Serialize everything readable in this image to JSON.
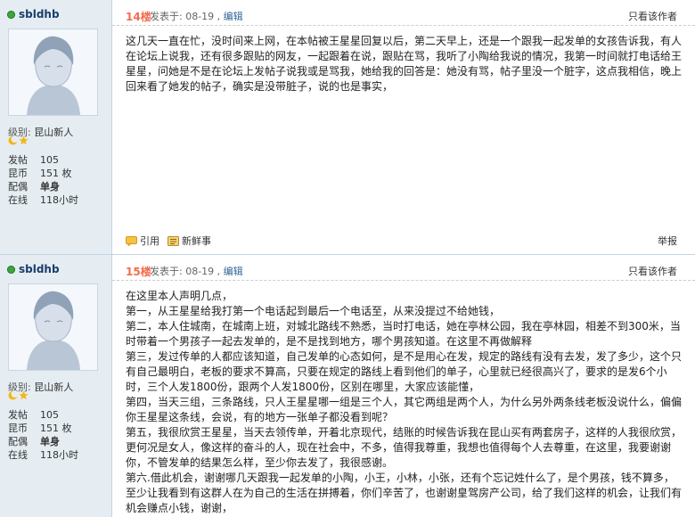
{
  "posts": [
    {
      "user": {
        "name": "sbldhb",
        "level_label": "级别:",
        "level": "昆山新人",
        "stats": [
          {
            "label": "发帖",
            "value": "105"
          },
          {
            "label": "昆币",
            "value": "151 枚"
          },
          {
            "label": "配偶",
            "value": "单身"
          },
          {
            "label": "在线",
            "value": "118小时"
          }
        ]
      },
      "floor": "14楼",
      "posted": "发表于: 08-19 , ",
      "edit": "编辑",
      "author_only": "只看该作者",
      "paragraphs": [
        "这几天一直在忙，没时间来上网，在本帖被王星星回复以后，第二天早上，还是一个跟我一起发单的女孩告诉我，有人在论坛上说我，还有很多跟贴的网友，一起跟着在说，跟贴在骂，我听了小陶给我说的情况，我第一时间就打电话给王星星，问她是不是在论坛上发帖子说我或是骂我，她给我的回答是：她没有骂，帖子里没一个脏字，这点我相信，晚上回来看了她发的帖子，确实是没带脏子，说的也是事实，"
      ],
      "actions": {
        "quote": "引用",
        "news": "新鲜事",
        "report": "举报"
      }
    },
    {
      "user": {
        "name": "sbldhb",
        "level_label": "级别:",
        "level": "昆山新人",
        "stats": [
          {
            "label": "发帖",
            "value": "105"
          },
          {
            "label": "昆币",
            "value": "151 枚"
          },
          {
            "label": "配偶",
            "value": "单身"
          },
          {
            "label": "在线",
            "value": "118小时"
          }
        ]
      },
      "floor": "15楼",
      "posted": "发表于: 08-19 , ",
      "edit": "编辑",
      "author_only": "只看该作者",
      "paragraphs": [
        "在这里本人声明几点，",
        "第一，从王星星给我打第一个电话起到最后一个电话至，从来没提过不给她钱，",
        "第二，本人住城南，在城南上班，对城北路线不熟悉，当时打电话，她在亭林公园，我在亭林园，相差不到300米，当时带着一个男孩子一起去发单的，是不是找到地方，哪个男孩知道。在这里不再做解释",
        "第三，发过传单的人都应该知道，自己发单的心态如何，是不是用心在发，规定的路线有没有去发，发了多少，这个只有自己最明白，老板的要求不算高，只要在规定的路线上看到他们的单子，心里就已经很高兴了，要求的是发6个小时，三个人发1800份，跟两个人发1800份，区别在哪里，大家应该能懂，",
        "第四，当天三组，三条路线，只人王星星哪一组是三个人，其它两组是两个人，为什么另外两条线老板没说什么，偏偏你王星星这条线，会说，有的地方一张单子都没看到呢？",
        "第五，我很欣赏王星星，当天去领传单，开着北京现代，结账的时候告诉我在昆山买有两套房子，这样的人我很欣赏，更何况是女人，像这样的奋斗的人，现在社会中，不多，值得我尊重，我想也值得每个人去尊重，在这里，我要谢谢你，不管发单的结果怎么样，至少你去发了，我很感谢。",
        "第六.借此机会，谢谢哪几天跟我一起发单的小陶，小王，小林，小张，还有个忘记姓什么了，是个男孩，钱不算多，至少让我看到有这群人在为自己的生活在拼搏着，你们辛苦了，也谢谢皇驾房产公司，给了我们这样的机会，让我们有机会赚点小钱，谢谢，"
      ],
      "actions": {
        "quote": "",
        "news": "",
        "report": ""
      }
    }
  ]
}
